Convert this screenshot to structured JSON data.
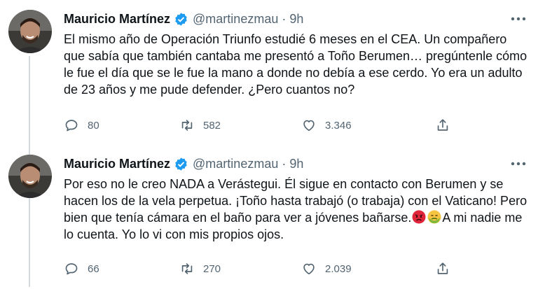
{
  "tweets": [
    {
      "author_name": "Mauricio Martínez",
      "handle": "@martinezmau",
      "separator": "·",
      "time": "9h",
      "text": "El mismo año de Operación Triunfo estudié 6 meses en el CEA. Un compañero que sabía que también cantaba me presentó a Toño Berumen… pregúntenle cómo le fue el día que se le fue la mano a donde no debía a ese cerdo. Yo era un adulto de 23 años y me pude defender. ¿Pero cuantos no?",
      "replies": "80",
      "retweets": "582",
      "likes": "3.346"
    },
    {
      "author_name": "Mauricio Martínez",
      "handle": "@martinezmau",
      "separator": "·",
      "time": "9h",
      "text_before_emoji": "Por eso no le creo NADA a Verástegui. Él sigue en contacto con Berumen y se hacen los de la vela perpetua. ¡Toño hasta trabajó (o trabaja) con el Vaticano! Pero bien que tenía cámara en el baño para ver a jóvenes bañarse.",
      "text_after_emoji": "A mi nadie me lo cuenta. Yo lo vi con mis propios ojos.",
      "emojis": [
        "angry-face-emoji",
        "nauseated-face-emoji"
      ],
      "replies": "66",
      "retweets": "270",
      "likes": "2.039"
    }
  ],
  "icons": {
    "verified": "verified-badge-icon",
    "more": "more-icon",
    "reply": "reply-icon",
    "retweet": "retweet-icon",
    "like": "like-icon",
    "share": "share-icon"
  },
  "colors": {
    "text": "#0f1419",
    "secondary": "#536471",
    "verified": "#1d9bf0",
    "thread_line": "#cfd9de"
  }
}
